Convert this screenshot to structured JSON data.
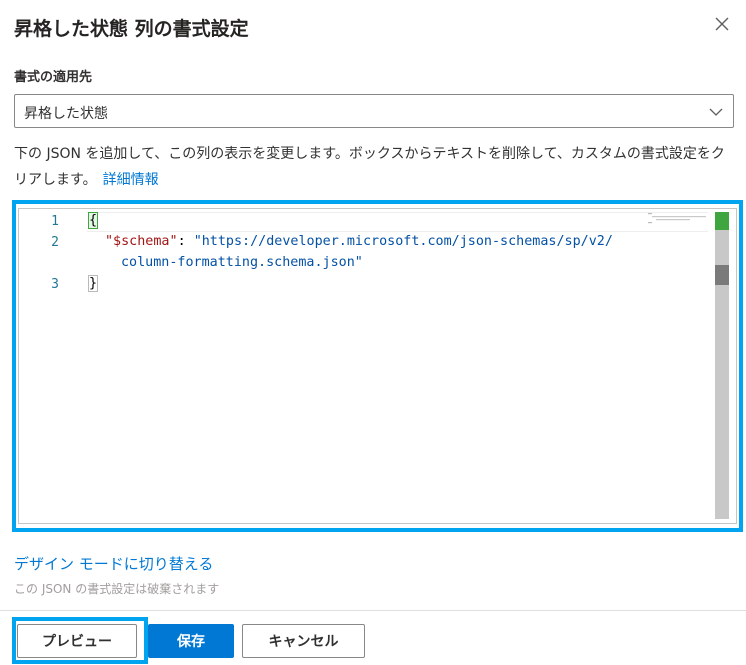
{
  "panel": {
    "title": "昇格した状態 列の書式設定",
    "close_icon": "close-icon"
  },
  "apply_to": {
    "label": "書式の適用先",
    "selected_value": "昇格した状態",
    "chevron_icon": "chevron-down-icon"
  },
  "description": {
    "text": "下の JSON を追加して、この列の表示を変更します。ボックスからテキストを削除して、カスタムの書式設定をクリアします。",
    "link_label": "詳細情報"
  },
  "editor": {
    "line_numbers": [
      "1",
      "2",
      "3"
    ],
    "lines": {
      "open_brace": "{",
      "schema_key": "\"$schema\"",
      "colon": ": ",
      "schema_value_part1": "\"https://developer.microsoft.com/json-schemas/sp/v2/",
      "schema_value_part2": "column-formatting.schema.json\"",
      "close_brace": "}"
    },
    "colors": {
      "accent_border": "#00a4ef",
      "key_color": "#a31515",
      "string_color": "#0451a5",
      "line_number_color": "#237893"
    }
  },
  "design_mode_link": "デザイン モードに切り替える",
  "note": "この JSON の書式設定は破棄されます",
  "footer": {
    "preview_label": "プレビュー",
    "save_label": "保存",
    "cancel_label": "キャンセル"
  },
  "colors": {
    "primary": "#0078d4",
    "highlight": "#00a4ef"
  }
}
